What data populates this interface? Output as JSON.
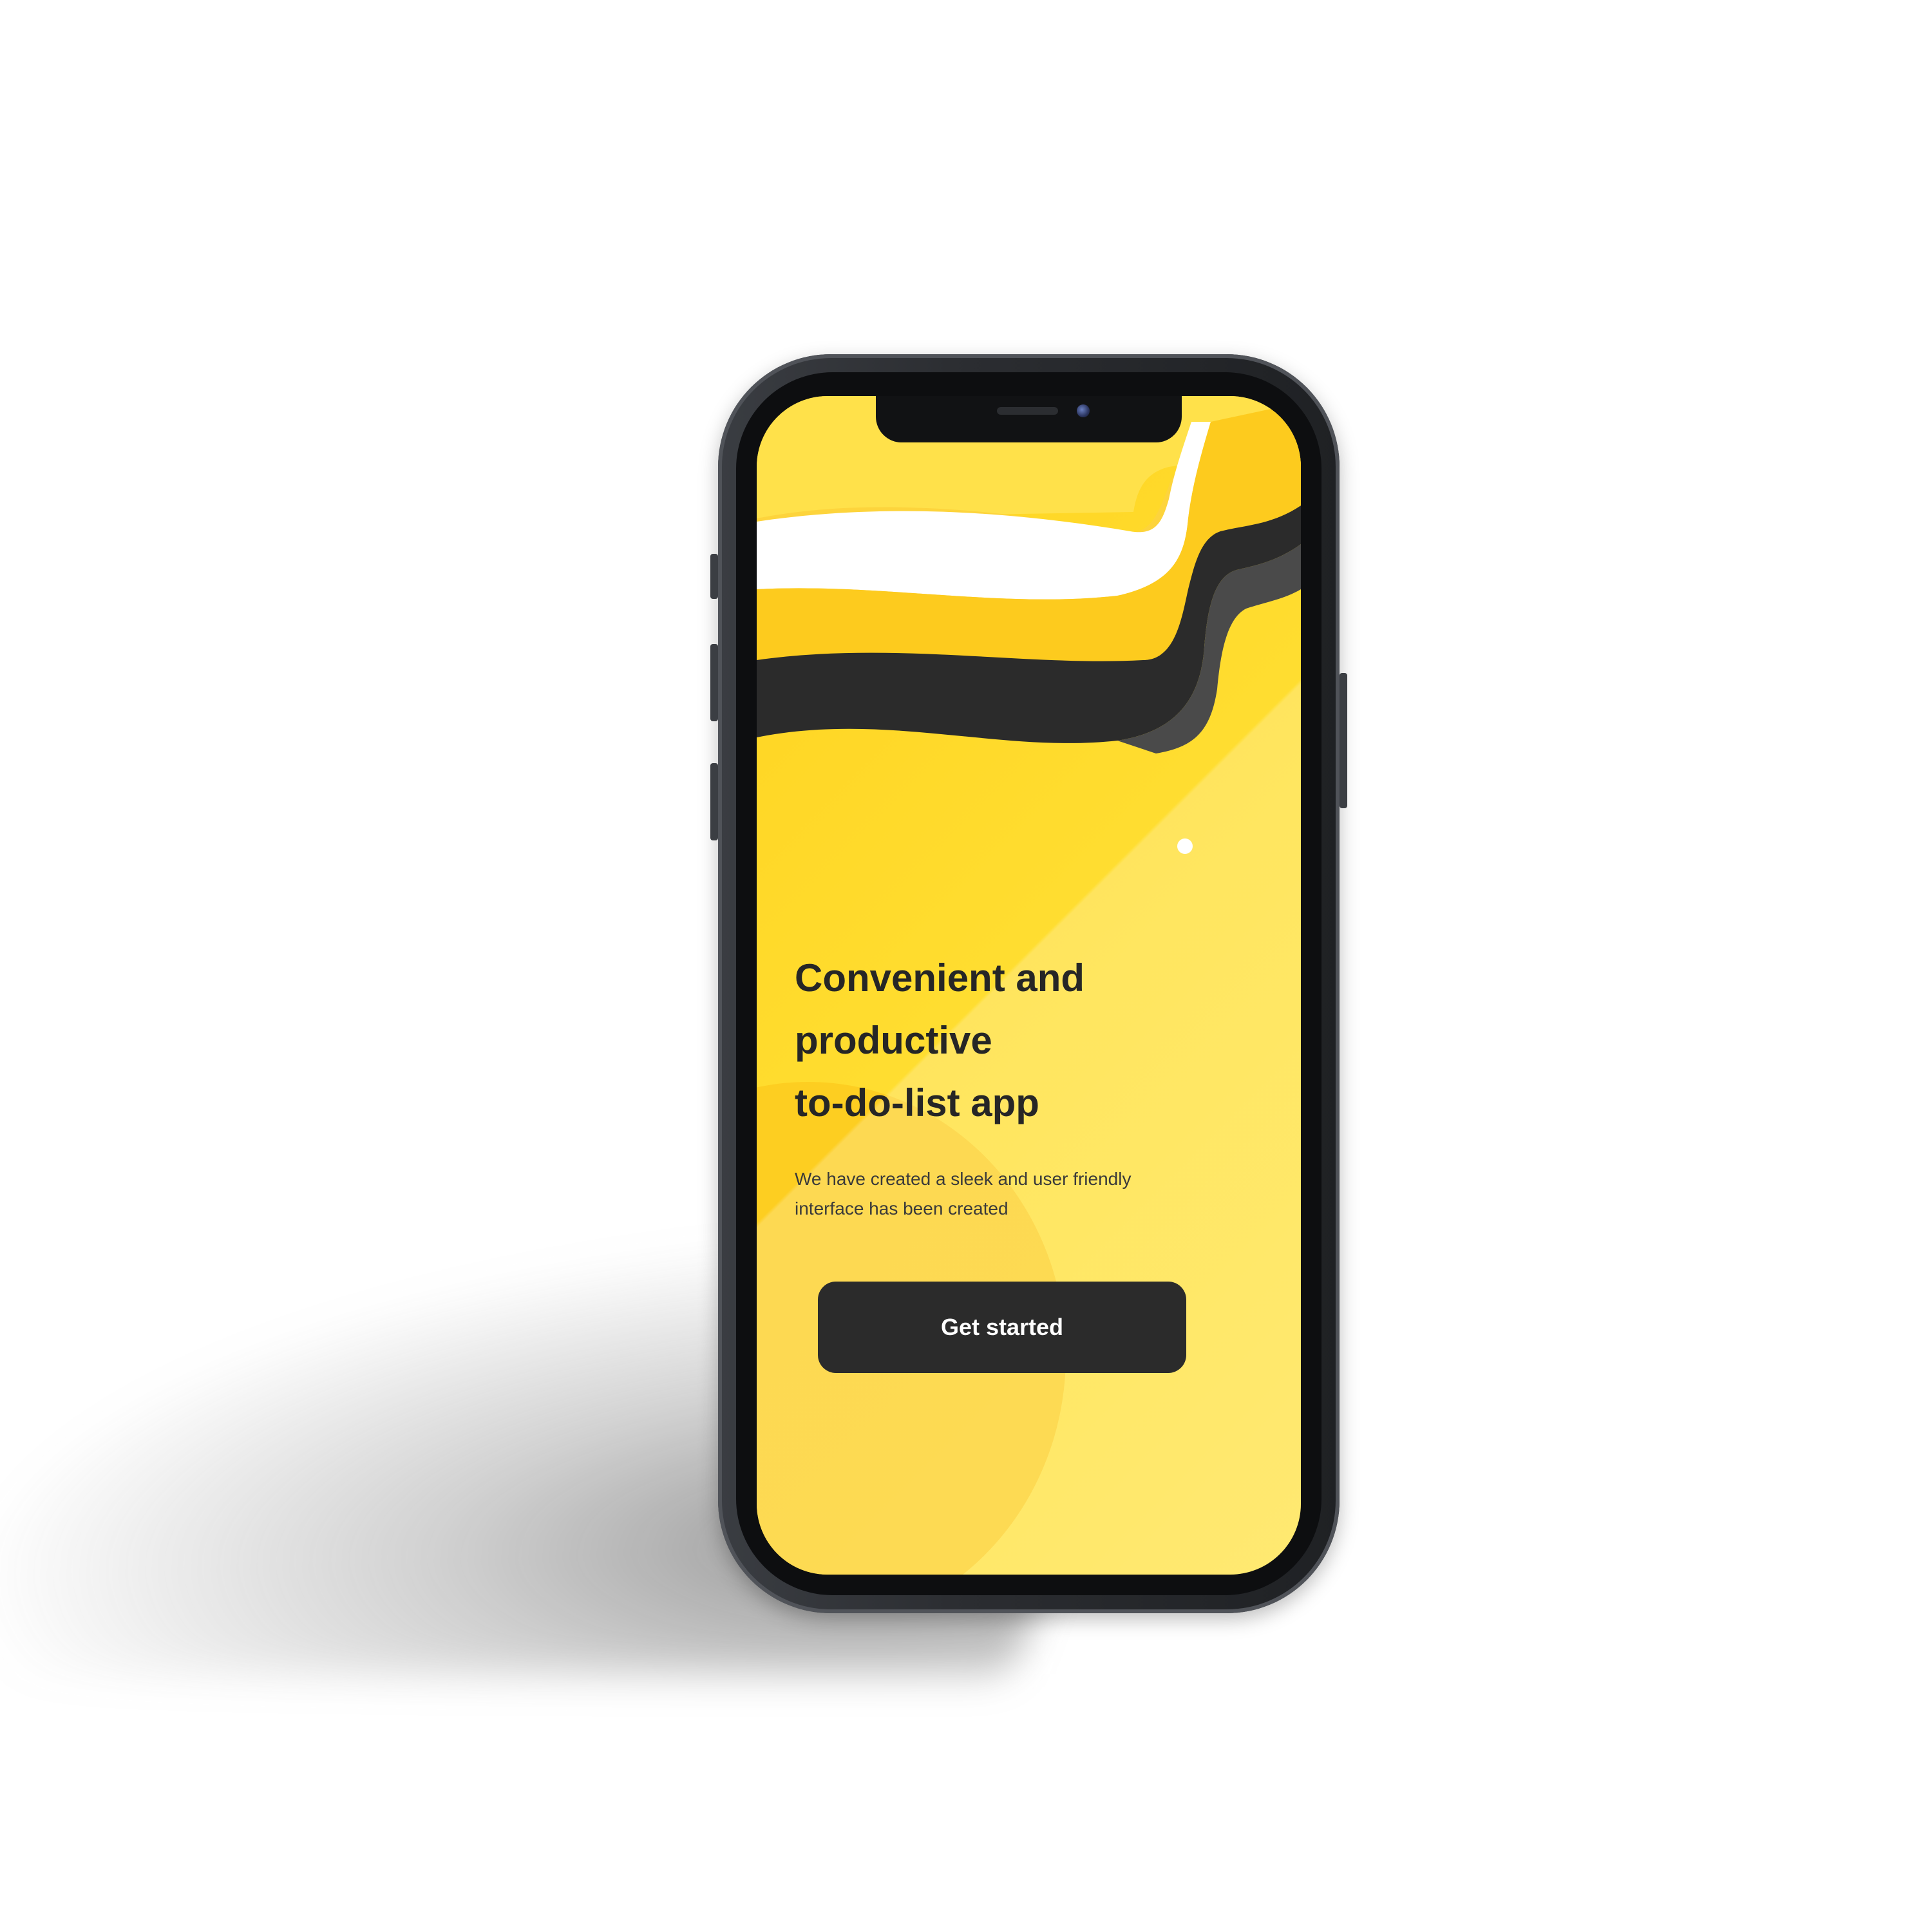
{
  "onboarding": {
    "headline_lines": [
      "Convenient and",
      "productive",
      "to-do-list app"
    ],
    "subtitle_lines": [
      "We have created a sleek and user friendly",
      "interface has been created"
    ],
    "cta_label": "Get started"
  },
  "colors": {
    "screen_yellow": "#ffdf33",
    "button_dark": "#2b2b2b",
    "wave_white": "#ffffff",
    "wave_dark": "#2b2b2b",
    "wave_gold": "#fdcb1e"
  }
}
